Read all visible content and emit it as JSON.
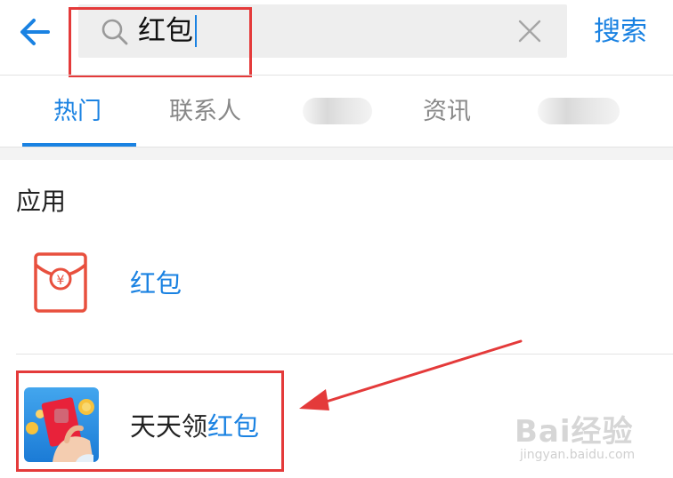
{
  "header": {
    "search_query": "红包",
    "search_button": "搜索"
  },
  "tabs": [
    {
      "label": "热门",
      "active": true
    },
    {
      "label": "联系人",
      "active": false
    },
    {
      "label": "",
      "active": false,
      "obscured": true
    },
    {
      "label": "资讯",
      "active": false
    },
    {
      "label": "",
      "active": false,
      "obscured": true
    }
  ],
  "section": {
    "title": "应用"
  },
  "results": [
    {
      "icon": "red-envelope-icon",
      "title_plain": "",
      "title_highlight": "红包"
    },
    {
      "icon": "tiantian-hongbao-app-icon",
      "title_plain": "天天领",
      "title_highlight": "红包"
    }
  ],
  "watermark": {
    "main": "Bai经验",
    "sub": "jingyan.baidu.com"
  },
  "colors": {
    "accent": "#1a82e2",
    "annotation_red": "#e43a3a",
    "envelope_red": "#e8503e"
  }
}
